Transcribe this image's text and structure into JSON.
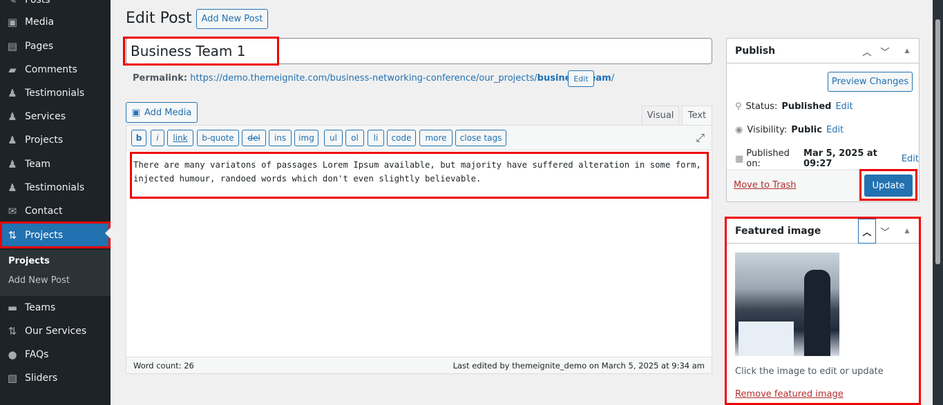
{
  "sidebar": {
    "items": [
      {
        "label": "Posts",
        "icon": "pin-icon"
      },
      {
        "label": "Media",
        "icon": "media-icon"
      },
      {
        "label": "Pages",
        "icon": "pages-icon"
      },
      {
        "label": "Comments",
        "icon": "comments-icon"
      },
      {
        "label": "Testimonials",
        "icon": "user-icon"
      },
      {
        "label": "Services",
        "icon": "user-icon"
      },
      {
        "label": "Projects",
        "icon": "user-icon"
      },
      {
        "label": "Team",
        "icon": "user-icon"
      },
      {
        "label": "Testimonials",
        "icon": "user-icon"
      },
      {
        "label": "Contact",
        "icon": "mail-icon"
      },
      {
        "label": "Projects",
        "icon": "sliders-icon"
      },
      {
        "label": "Teams",
        "icon": "teams-icon"
      },
      {
        "label": "Our Services",
        "icon": "sliders-icon"
      },
      {
        "label": "FAQs",
        "icon": "chat-icon"
      },
      {
        "label": "Sliders",
        "icon": "slides-icon"
      }
    ],
    "submenu": [
      "Projects",
      "Add New Post"
    ]
  },
  "header": {
    "title": "Edit Post",
    "add_new": "Add New Post"
  },
  "post": {
    "title": "Business Team 1",
    "permalink_label": "Permalink:",
    "permalink_base": "https://demo.themeignite.com/business-networking-conference/our_projects/",
    "permalink_slug": "business-team",
    "permalink_end": "/",
    "permalink_edit": "Edit"
  },
  "editor": {
    "add_media": "Add Media",
    "tabs": [
      "Visual",
      "Text"
    ],
    "active_tab": "Text",
    "buttons": [
      "b",
      "i",
      "link",
      "b-quote",
      "del",
      "ins",
      "img",
      "ul",
      "ol",
      "li",
      "code",
      "more",
      "close tags"
    ],
    "content": "There are many variatons of passages Lorem Ipsum available, but majority have suffered alteration in some form, injected humour, randoed words which don't even slightly believable.",
    "word_count": "Word count: 26",
    "last_edited": "Last edited by themeignite_demo on March 5, 2025 at 9:34 am"
  },
  "publish": {
    "title": "Publish",
    "preview": "Preview Changes",
    "status_label": "Status:",
    "status": "Published",
    "visibility_label": "Visibility:",
    "visibility": "Public",
    "published_label": "Published on:",
    "published": "Mar 5, 2025 at 09:27",
    "edit": "Edit",
    "trash": "Move to Trash",
    "update": "Update"
  },
  "featured": {
    "title": "Featured image",
    "hint": "Click the image to edit or update",
    "remove": "Remove featured image"
  },
  "colors": {
    "accent": "#2271b1",
    "sidebar": "#1d2327",
    "highlight": "#e00000",
    "trash": "#b32d2e"
  }
}
